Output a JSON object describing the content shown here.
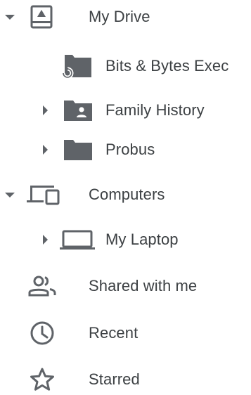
{
  "tree": {
    "my_drive": {
      "label": "My Drive",
      "icon": "drive-icon",
      "expanded": true
    },
    "drive_children": [
      {
        "label": "Bits & Bytes Exec",
        "icon": "shortcut-folder-icon"
      },
      {
        "label": "Family History",
        "icon": "shared-folder-icon",
        "expandable": true
      },
      {
        "label": "Probus",
        "icon": "folder-icon",
        "expandable": true
      }
    ],
    "computers": {
      "label": "Computers",
      "icon": "computers-icon",
      "expanded": true
    },
    "computer_children": [
      {
        "label": "My Laptop",
        "icon": "laptop-icon",
        "expandable": true
      }
    ],
    "shared_with_me": {
      "label": "Shared with me",
      "icon": "people-icon"
    },
    "recent": {
      "label": "Recent",
      "icon": "clock-icon"
    },
    "starred": {
      "label": "Starred",
      "icon": "star-icon"
    }
  },
  "colors": {
    "text": "#3c4043",
    "icon": "#5f6368",
    "folder": "#5f6368"
  }
}
